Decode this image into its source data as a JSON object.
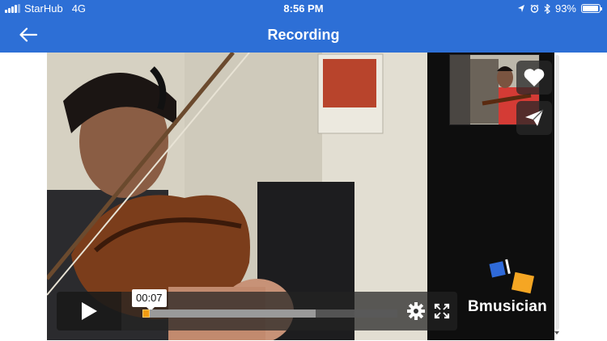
{
  "status_bar": {
    "carrier": "StarHub",
    "network": "4G",
    "time": "8:56 PM",
    "battery": "93%",
    "battery_level": 0.93
  },
  "app_bar": {
    "title": "Recording",
    "back_icon": "arrow-left-icon"
  },
  "player": {
    "current_time": "00:07",
    "played_fraction": 0.03,
    "buffered_fraction": 0.68,
    "play_icon": "play-icon",
    "settings_icon": "gear-icon",
    "fullscreen_icon": "fullscreen-icon"
  },
  "side_actions": {
    "like_icon": "heart-icon",
    "share_icon": "send-icon"
  },
  "brand": {
    "name": "Bmusician",
    "colors": [
      "#2f6ad9",
      "#f5a623"
    ]
  },
  "theme": {
    "primary": "#2d6fd6",
    "progress": "#f39c12"
  }
}
